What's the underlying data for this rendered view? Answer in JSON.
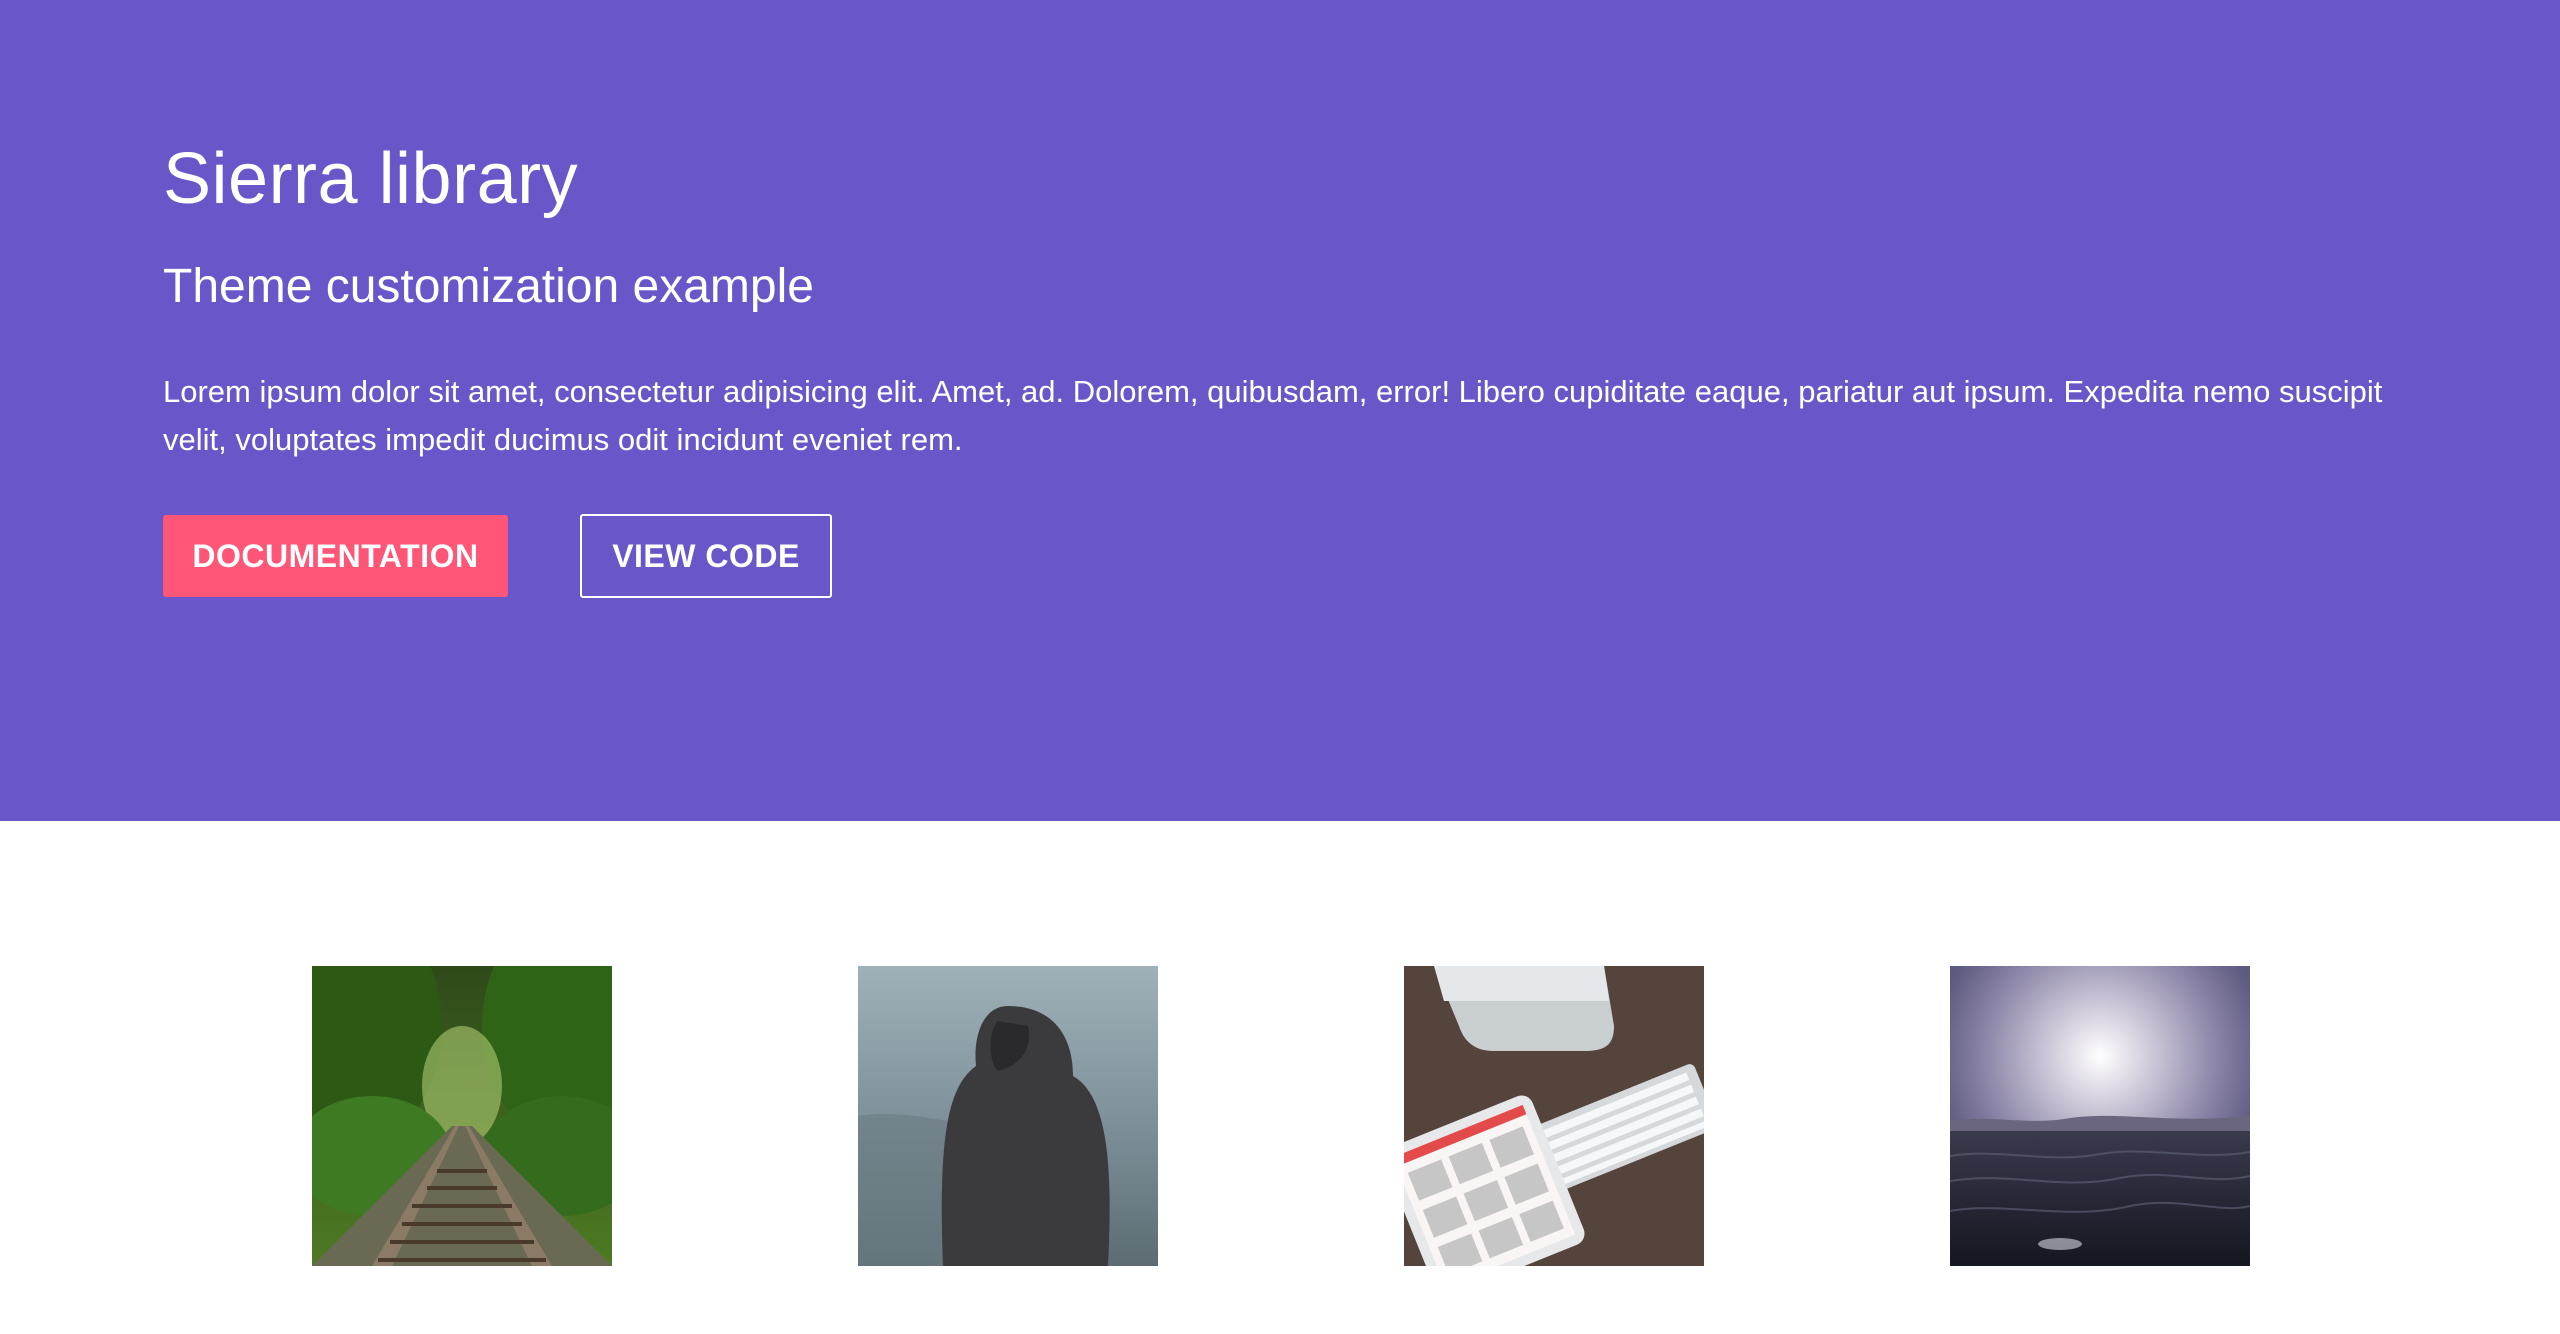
{
  "hero": {
    "title": "Sierra library",
    "subtitle": "Theme customization example",
    "text": "Lorem ipsum dolor sit amet, consectetur adipisicing elit. Amet, ad. Dolorem, quibusdam, error! Libero cupiditate eaque, pariatur aut ipsum. Expedita nemo suscipit velit, voluptates impedit ducimus odit incidunt eveniet rem.",
    "primary_button": "DOCUMENTATION",
    "secondary_button": "VIEW CODE"
  },
  "colors": {
    "hero_background": "#6957c9",
    "primary_button": "#ff5577",
    "text": "#ffffff",
    "page_background": "#ffffff"
  },
  "gallery": {
    "images": [
      {
        "icon": "forest-railway-photo"
      },
      {
        "icon": "hooded-person-sea-photo"
      },
      {
        "icon": "desk-tablet-keyboard-photo"
      },
      {
        "icon": "ocean-sunset-photo"
      }
    ]
  }
}
